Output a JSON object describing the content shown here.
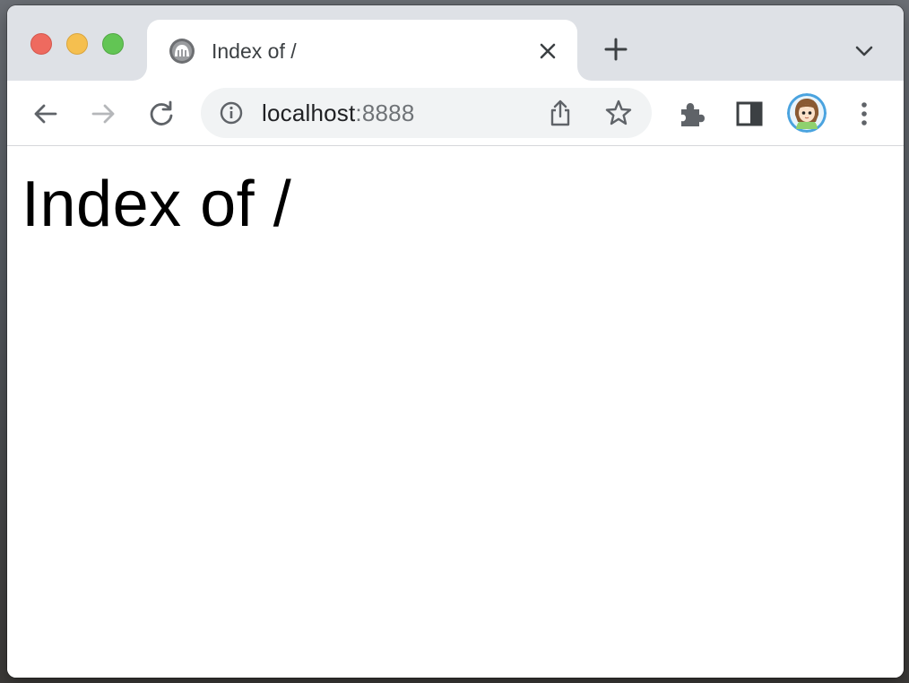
{
  "window": {
    "controls": [
      "close",
      "minimize",
      "maximize"
    ]
  },
  "tab": {
    "title": "Index of /",
    "favicon": "server-favicon-icon"
  },
  "toolbar": {
    "url_host": "localhost",
    "url_port": ":8888",
    "icons": {
      "back": "arrow-left-icon",
      "forward": "arrow-right-icon",
      "reload": "reload-icon",
      "info": "info-icon",
      "share": "share-icon",
      "bookmark": "star-icon",
      "extensions": "puzzle-icon",
      "side_panel": "side-panel-icon",
      "menu": "kebab-menu-icon"
    }
  },
  "page": {
    "heading": "Index of /"
  },
  "colors": {
    "titlebar": "#dee1e6",
    "omnibox": "#f1f3f4",
    "icon": "#5f6368",
    "icon_disabled": "#b5b7ba",
    "close": "#ee6a5f",
    "minimize": "#f5bf4f",
    "maximize": "#62c554"
  }
}
